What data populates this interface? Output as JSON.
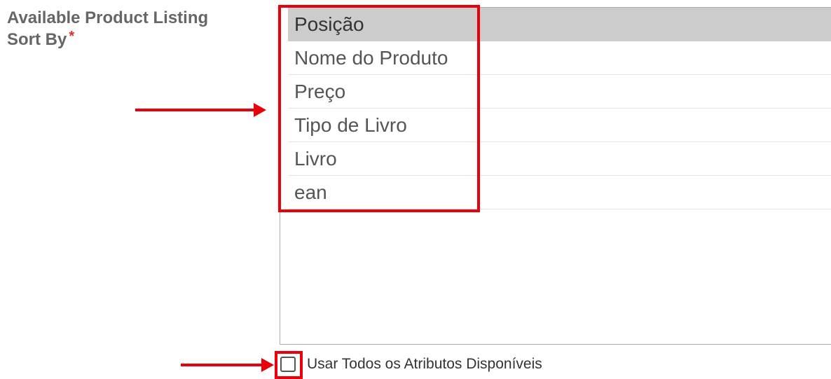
{
  "field": {
    "label_line1": "Available Product Listing",
    "label_line2": "Sort By",
    "required_mark": "*"
  },
  "sort_options": {
    "selected": "Posição",
    "items": [
      "Posição",
      "Nome do Produto",
      "Preço",
      "Tipo de Livro",
      "Livro",
      "ean"
    ]
  },
  "use_all_attributes": {
    "label": "Usar Todos os Atributos Disponíveis",
    "checked": false
  },
  "colors": {
    "annotation_red": "#e8000b",
    "selected_row_bg": "#cccccc",
    "required_star": "#e02b27",
    "label_gray": "#666666"
  }
}
